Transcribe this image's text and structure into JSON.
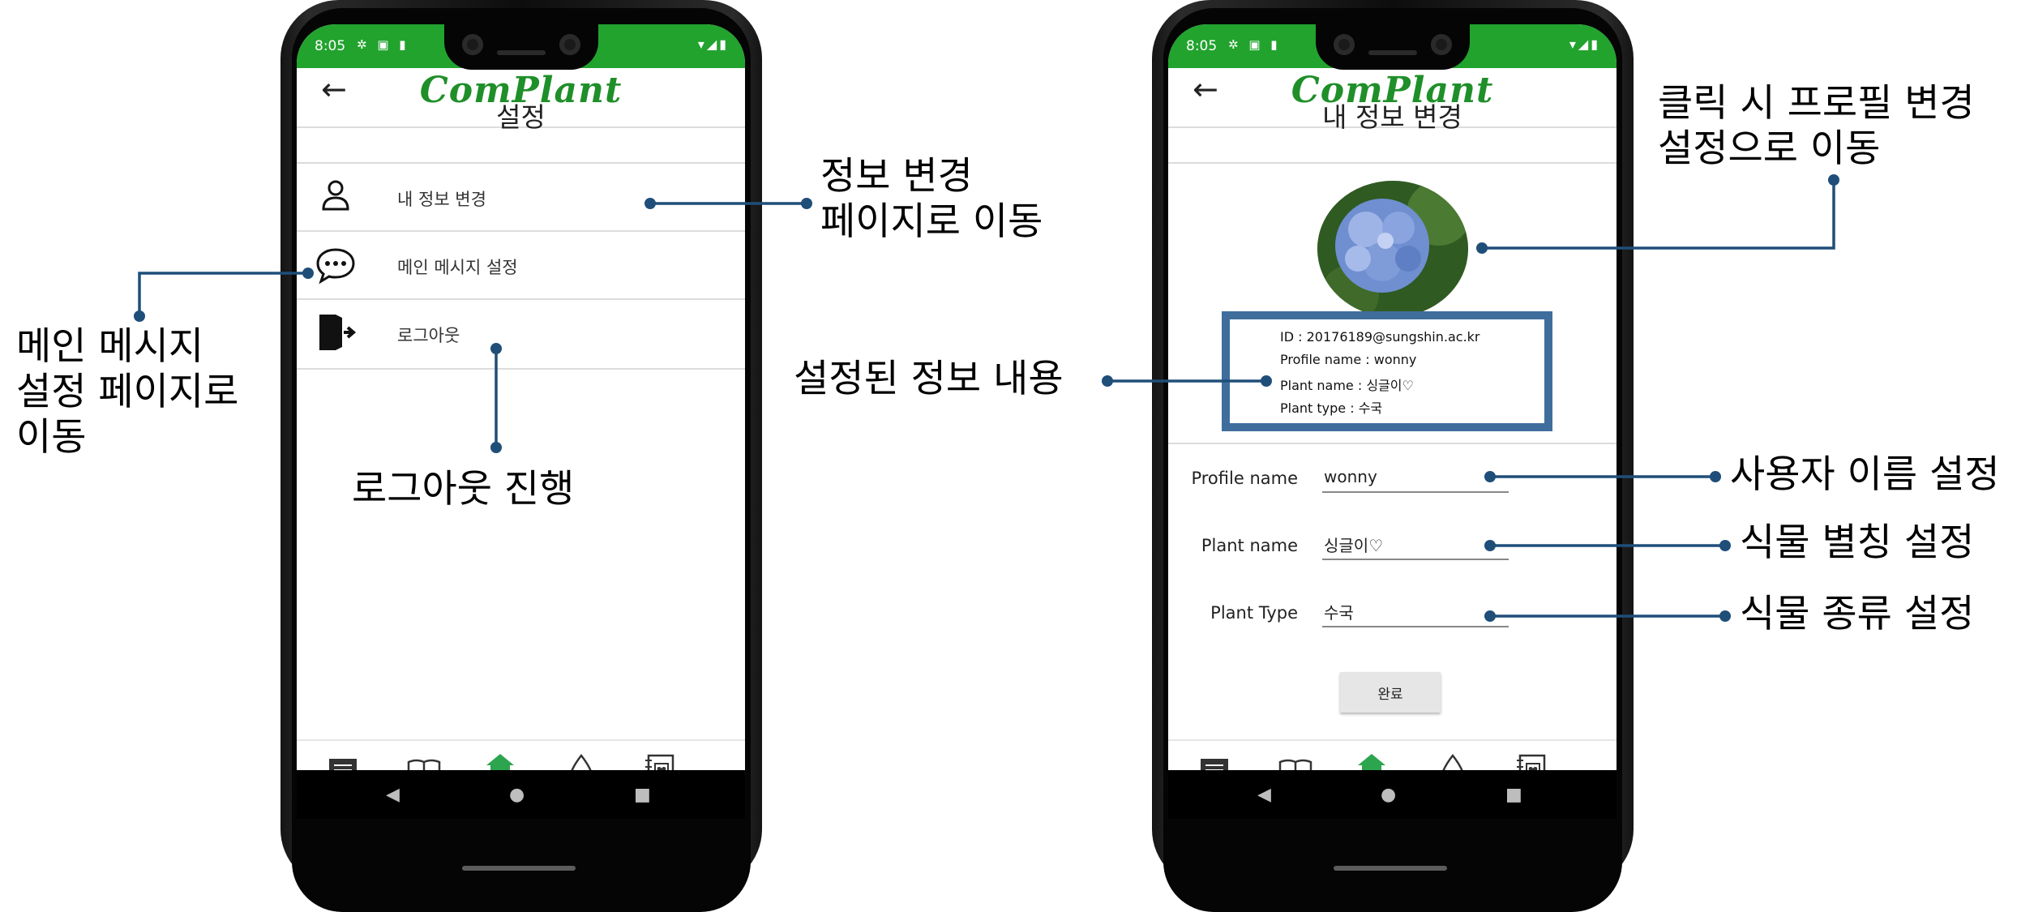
{
  "status_bar": {
    "time": "8:05"
  },
  "app": {
    "logo": "ComPlant"
  },
  "left_screen": {
    "title": "설정",
    "menu": [
      {
        "label": "내 정보 변경",
        "icon": "person-icon"
      },
      {
        "label": "메인 메시지 설정",
        "icon": "chat-bubble-icon"
      },
      {
        "label": "로그아웃",
        "icon": "logout-icon"
      }
    ]
  },
  "right_screen": {
    "title": "내 정보 변경",
    "info": {
      "id_line": "ID : 20176189@sungshin.ac.kr",
      "profile_line": "Profile name : wonny",
      "plant_name_line": "Plant name : 싱글이♡",
      "plant_type_line": "Plant type : 수국"
    },
    "form": {
      "profile_label": "Profile name",
      "profile_value": "wonny",
      "plant_name_label": "Plant name",
      "plant_name_value": "싱글이♡",
      "plant_type_label": "Plant Type",
      "plant_type_value": "수국"
    },
    "done_label": "완료"
  },
  "bottom_nav": {
    "home_label": "home"
  },
  "annotations": {
    "info_change_1": "정보 변경",
    "info_change_2": "페이지로 이동",
    "main_msg_1": "메인 메시지",
    "main_msg_2": "설정 페이지로",
    "main_msg_3": "이동",
    "logout": "로그아웃 진행",
    "profile_click_1": "클릭 시 프로필 변경",
    "profile_click_2": "설정으로 이동",
    "set_info": "설정된 정보 내용",
    "user_name": "사용자 이름 설정",
    "plant_nick": "식물 별칭 설정",
    "plant_kind": "식물 종류 설정"
  },
  "colors": {
    "accent_green": "#22a32e",
    "annotation_blue": "#1f4e79",
    "info_border": "#3f6e9d"
  }
}
